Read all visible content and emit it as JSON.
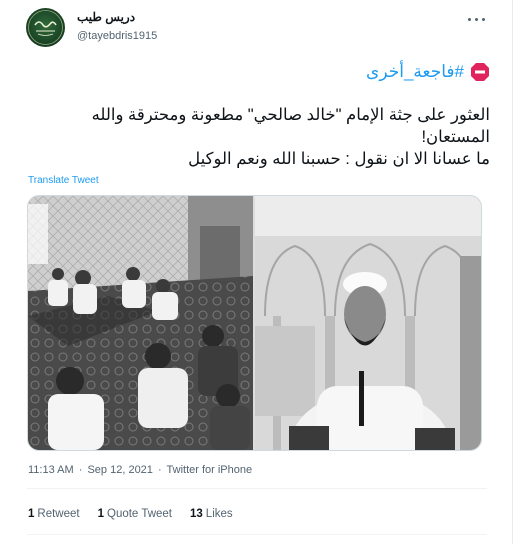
{
  "tweet": {
    "display_name": "دريس طيب",
    "handle": "@tayebdris1915",
    "hashtag": "#فاجعة_أخرى",
    "body_line1": "العثور على جثة الإمام \"خالد صالحي\" مطعونة ومحترقة والله",
    "body_line2": "المستعان!",
    "body_line3": "ما عسانا الا ان نقول : حسبنا الله ونعم الوكيل",
    "translate_label": "Translate Tweet",
    "time": "11:13 AM",
    "date": "Sep 12, 2021",
    "source": "Twitter for iPhone",
    "separator": "·"
  },
  "stats": {
    "retweets_count": "1",
    "retweets_label": "Retweet",
    "quotes_count": "1",
    "quotes_label": "Quote Tweet",
    "likes_count": "13",
    "likes_label": "Likes"
  },
  "icons": {
    "stop": "stop-sign-icon",
    "more": "more-options-icon"
  },
  "colors": {
    "link": "#1d9bf0",
    "secondary_text": "#536471",
    "primary_text": "#0f1419",
    "stop_sign": "#e0245e"
  }
}
